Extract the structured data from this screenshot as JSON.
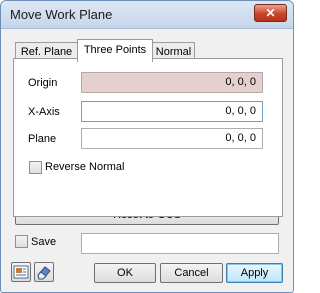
{
  "window": {
    "title": "Move Work Plane",
    "close_glyph": "✕"
  },
  "tabs": [
    {
      "label": "Ref. Plane",
      "active": false
    },
    {
      "label": "Three Points",
      "active": true
    },
    {
      "label": "Normal",
      "active": false
    }
  ],
  "fields": {
    "origin": {
      "label": "Origin",
      "value": "0, 0, 0"
    },
    "xaxis": {
      "label": "X-Axis",
      "value": "0, 0, 0"
    },
    "plane": {
      "label": "Plane",
      "value": "0, 0, 0"
    }
  },
  "reverse_normal": {
    "label": "Reverse Normal",
    "checked": false
  },
  "reset_label": "Reset to GCS",
  "save": {
    "label": "Save",
    "checked": false,
    "value": ""
  },
  "buttons": {
    "ok": "OK",
    "cancel": "Cancel",
    "apply": "Apply"
  },
  "icons": {
    "left": "properties-icon",
    "right": "eraser-icon"
  },
  "colors": {
    "origin_field_bg": "#e6cfcf",
    "close_button": "#c7472b",
    "title_bar": "#c6d6ea"
  }
}
